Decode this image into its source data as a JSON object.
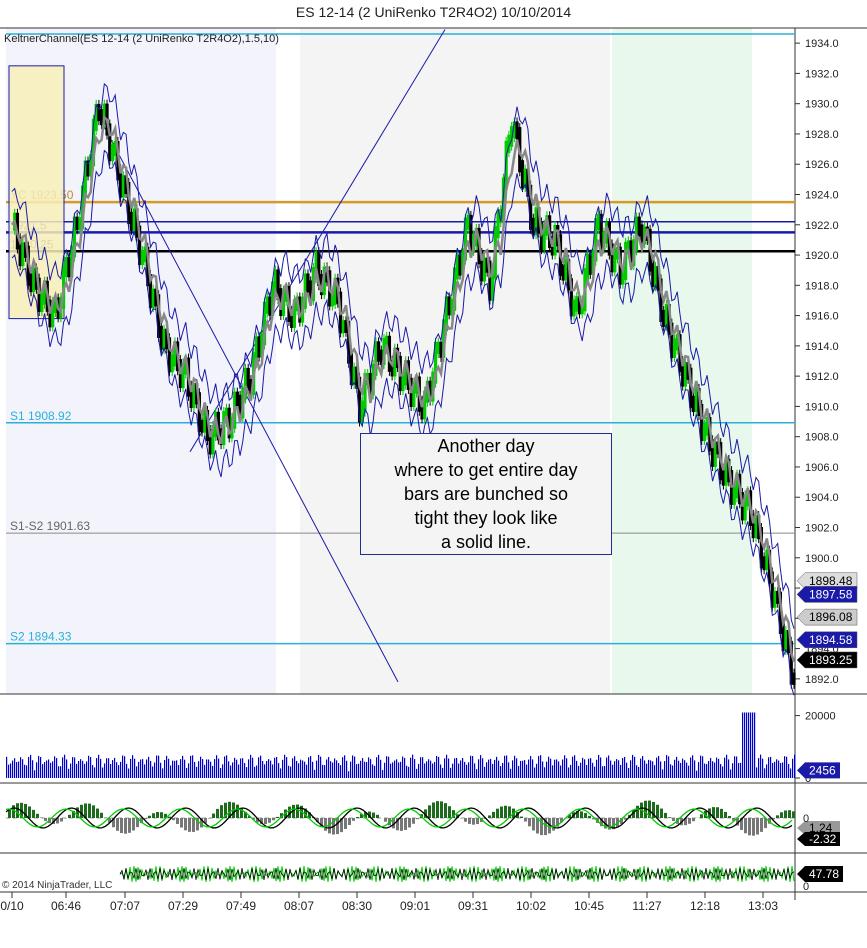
{
  "title": "ES 12-14 (2 UniRenko T2R4O2)  10/10/2014",
  "indicator_label": "KeltnerChannel(ES 12-14 (2 UniRenko T2R4O2),1.5,10)",
  "annotation": [
    "Another day",
    "where to get entire day",
    "bars are bunched so",
    "tight they look like",
    "a solid line."
  ],
  "copyright": "© 2014 NinjaTrader, LLC",
  "colors": {
    "up": "#00cc00",
    "down": "#000000",
    "keltner": "#1a1aa8",
    "pivot": "#2ab0d8",
    "volume": "#0000cc"
  },
  "chart_data": {
    "type": "line",
    "title": "ES 12-14 (2 UniRenko T2R4O2)  10/10/2014",
    "ylim": [
      1891,
      1935
    ],
    "y_ticks": [
      1892,
      1894,
      1896,
      1898,
      1900,
      1902,
      1904,
      1906,
      1908,
      1910,
      1912,
      1914,
      1916,
      1918,
      1920,
      1922,
      1924,
      1926,
      1928,
      1930,
      1932,
      1934
    ],
    "x_ticks": [
      "0/10",
      "06:46",
      "07:07",
      "07:29",
      "07:49",
      "08:07",
      "08:30",
      "09:01",
      "09:31",
      "10:02",
      "10:45",
      "11:27",
      "12:18",
      "13:03"
    ],
    "levels": [
      {
        "label": "S1 1908.92",
        "value": 1908.92
      },
      {
        "label": "S1-S2 1901.63",
        "value": 1901.63
      },
      {
        "label": "S2 1894.33",
        "value": 1894.33
      },
      {
        "label": "YC 1923.50",
        "value": 1923.5
      },
      {
        "label": "1921.5",
        "value": 1921.5
      },
      {
        "label": "1920.25",
        "value": 1920.25
      }
    ],
    "price_labels": [
      {
        "label": "1898.48",
        "value": 1898.48
      },
      {
        "label": "1897.58",
        "value": 1897.58
      },
      {
        "label": "1896.08",
        "value": 1896.08
      },
      {
        "label": "1894.58",
        "value": 1894.58
      },
      {
        "label": "1893.25",
        "value": 1893.25
      }
    ],
    "series": [
      {
        "values": [
          1922,
          1918,
          1916,
          1922,
          1930,
          1925,
          1920,
          1914,
          1912,
          1908,
          1909,
          1912,
          1918,
          1916,
          1919,
          1917,
          1910,
          1914,
          1912,
          1910,
          1916,
          1922,
          1918,
          1929,
          1922,
          1921,
          1916,
          1922,
          1919,
          1922,
          1916,
          1912,
          1908,
          1905,
          1903,
          1898,
          1892
        ]
      }
    ],
    "volume_panel": {
      "ylim": [
        0,
        25000
      ],
      "y_ticks": [
        0,
        20000
      ],
      "last_label": "2456",
      "last_value": 2456
    },
    "oscillator_panel": {
      "y_ticks": [
        0
      ],
      "labels": [
        "1.24",
        "-2.32"
      ]
    },
    "momentum_panel": {
      "y_ticks": [
        0
      ],
      "last_label": "47.78",
      "last_value": 47.78
    }
  }
}
